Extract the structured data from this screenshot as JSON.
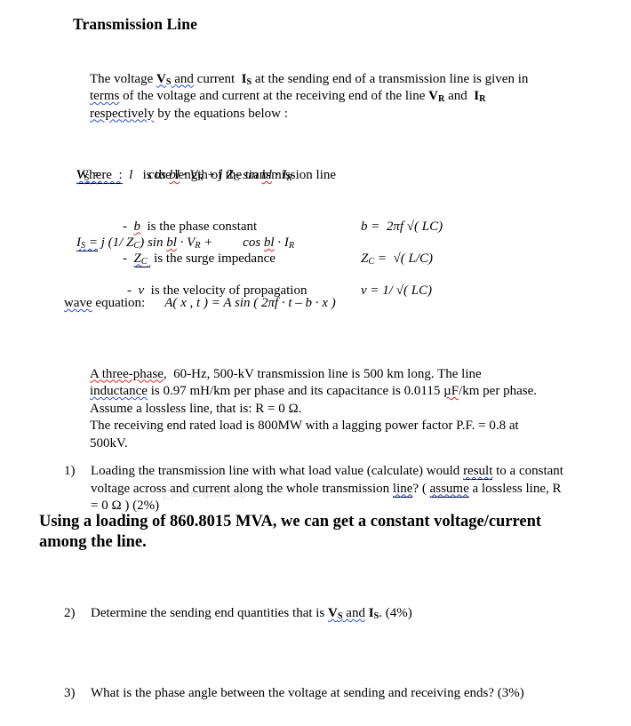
{
  "document": {
    "title": "Transmission Line",
    "intro": {
      "line1_a": "The voltage ",
      "line1_vs": "V",
      "line1_vs_sub": "S",
      "line1_and": " and",
      "line1_b": " current  ",
      "line1_is": "I",
      "line1_is_sub": "S",
      "line1_c": " at the sending end of a transmission line is given in",
      "line2_terms": "terms",
      "line2_b": " of the voltage and current at the receiving end of the line ",
      "line2_vr": "V",
      "line2_vr_sub": "R",
      "line2_c": " and  ",
      "line2_ir": "I",
      "line2_ir_sub": "R",
      "line3_resp": "respectively",
      "line3_b": " by the equations below :"
    },
    "equations": {
      "eq1_lhs": "V",
      "eq1_lhs_sub": "S",
      "eq1_eq": " =",
      "eq1_gap": "              ",
      "eq1_cos": "cos ",
      "eq1_bl": "bl",
      "eq1_rest_a": " · V",
      "eq1_rest_a_sub": "R",
      "eq1_rest_b": " + j Z",
      "eq1_rest_b_sub": "C",
      "eq1_sin": " sin ",
      "eq1_bl2": "bl",
      "eq1_rest_c": " · I",
      "eq1_rest_c_sub": "R",
      "eq2_lhs": "I",
      "eq2_lhs_sub": "S",
      "eq2_eq": " =",
      "eq2_a": " j (1/ Z",
      "eq2_a_sub": "C",
      "eq2_b": ") sin ",
      "eq2_bl": "bl",
      "eq2_c": " · V",
      "eq2_c_sub": "R",
      "eq2_d": " + ",
      "eq2_gap": "        ",
      "eq2_cos": "cos ",
      "eq2_bl2": "bl",
      "eq2_e": " · I",
      "eq2_e_sub": "R"
    },
    "where": {
      "label": "Where  :",
      "symbol": "l",
      "text": "is the length of the transmission line"
    },
    "definitions": [
      {
        "bullet": "-",
        "symbol": "b",
        "text": "is the phase constant",
        "formula_lhs": "b",
        "formula_rhs": "=  2πf √( LC)"
      },
      {
        "bullet": "-",
        "symbol": "Z",
        "symbol_sub": "C",
        "text": "is the surge impedance",
        "formula_lhs": "Z",
        "formula_lhs_sub": "C",
        "formula_rhs": "=  √( L/C)"
      },
      {
        "bullet": "-",
        "symbol": "v",
        "text": "is the velocity of propagation",
        "formula_lhs": "v",
        "formula_rhs": "= 1/ √( LC)"
      }
    ],
    "wave_equation": {
      "label_sq": "wave",
      "label_rest": " equation:",
      "formula": "A( x , t ) = A sin ( 2πf · t – b · x )"
    },
    "problem": {
      "line1_a": "A three-phase",
      "line1_b": ",  60",
      "line1_c": "-Hz, 500-kV transmission line is 500 km long. The line",
      "line2_a": "inductance",
      "line2_b": " is 0.97 mH/km per phase and its capacitance is 0.0115 ",
      "line2_uf": "µF",
      "line2_c": "/km per phase.",
      "line3": "Assume a lossless line, that is: R = 0 Ω.",
      "line4": "The receiving end rated load is 800MW with a lagging power factor P.F. = 0.8 at",
      "line5": "500kV."
    },
    "questions": [
      {
        "number": "1)",
        "line1": "Loading the transmission line with what load value (calculate) would",
        "line2_a": "result",
        "line2_b": " to a constant voltage across and current along the whole transmission",
        "line3_a": "line",
        "line3_b": "? ( ",
        "line3_c": "assume",
        "line3_d": " a lossless line, R = 0 Ω  ) (2%)"
      },
      {
        "number": "2)",
        "text_a": "Determine the sending end quantities that is ",
        "text_vs": "V",
        "text_vs_sub": "S",
        "text_and": " and",
        "text_b": "  I",
        "text_b_sub": "S",
        "text_c": ". (4%)"
      },
      {
        "number": "3)",
        "text": "What is the phase angle between the voltage at sending and receiving ends? (3%)"
      }
    ],
    "answer": "Using a loading of 860.8015 MVA, we can get a constant voltage/current among the line.",
    "artifact": {
      "ghost_text": "Rectangular Snip"
    }
  },
  "colors": {
    "page_background": "#ffffff",
    "text": "#000000",
    "spellcheck_red": "#e02020",
    "grammarcheck_blue": "#2b4fd8"
  }
}
